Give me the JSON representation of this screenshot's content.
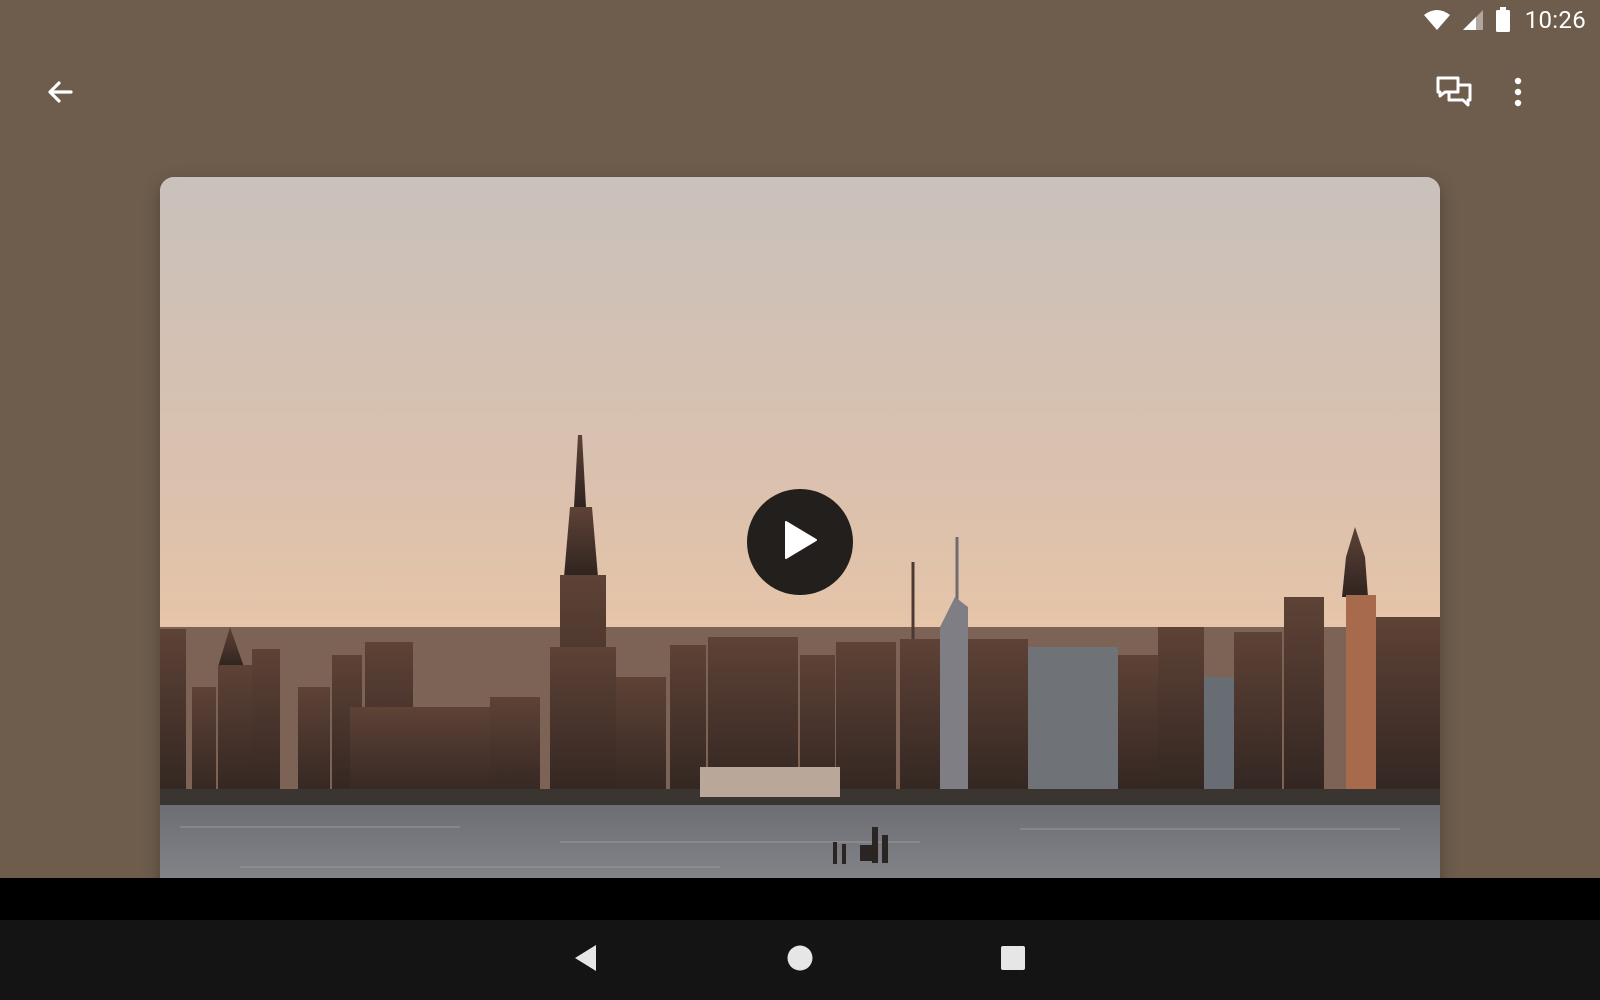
{
  "status_bar": {
    "time": "10:26",
    "icons": [
      "wifi-icon",
      "cell-signal-icon",
      "battery-icon"
    ]
  },
  "app_bar": {
    "icons": [
      "back-arrow-icon",
      "comments-icon",
      "more-vert-icon"
    ]
  },
  "media": {
    "type": "video",
    "overlay_icon": "play-icon"
  },
  "nav_bar": {
    "icons": [
      "nav-back-icon",
      "nav-home-icon",
      "nav-recents-icon"
    ]
  },
  "colors": {
    "background": "#6e5d4d",
    "play_button": "#231f1d",
    "nav_bar": "#141414"
  }
}
